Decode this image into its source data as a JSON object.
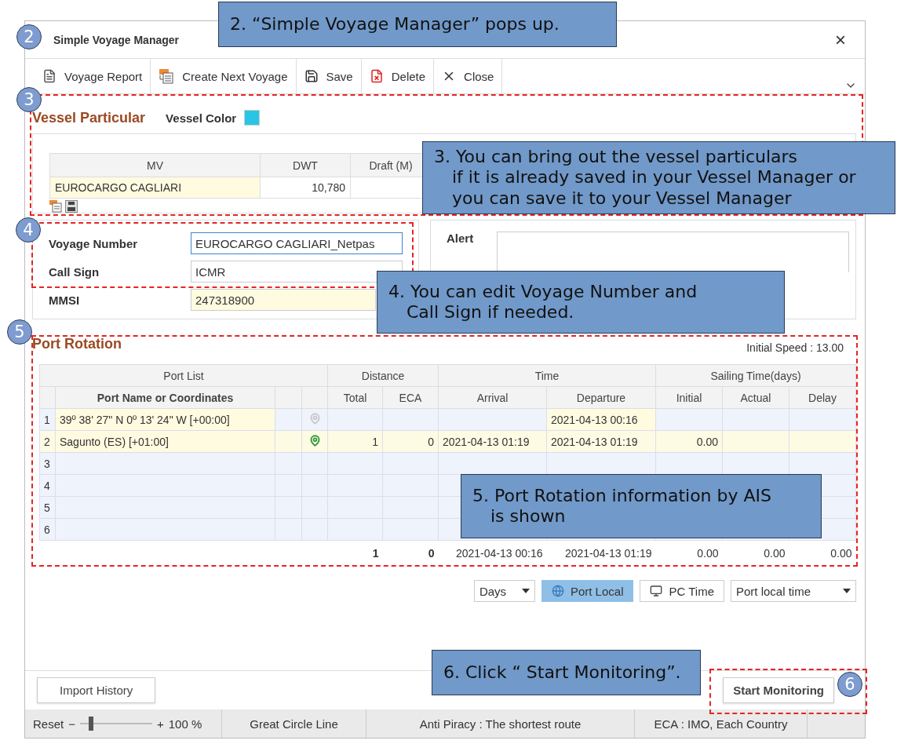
{
  "window": {
    "title": "Simple Voyage Manager",
    "close": "×"
  },
  "toolbar": [
    {
      "kind": "report",
      "label": "Voyage Report"
    },
    {
      "kind": "next",
      "label": "Create Next Voyage"
    },
    {
      "kind": "save",
      "label": "Save"
    },
    {
      "kind": "delete",
      "label": "Delete"
    },
    {
      "kind": "close",
      "label": "Close"
    }
  ],
  "vessel": {
    "title": "Vessel Particular",
    "color_label": "Vessel Color",
    "color": "#29c5e6",
    "columns": [
      "MV",
      "DWT",
      "Draft (M)"
    ],
    "row": {
      "mv": "EUROCARGO CAGLIARI",
      "dwt": "10,780"
    }
  },
  "voyage_fields": [
    {
      "label": "Voyage Number",
      "value": "EUROCARGO CAGLIARI_Netpas",
      "focused": true,
      "readonly": false
    },
    {
      "label": "Call Sign",
      "value": "ICMR",
      "focused": false,
      "readonly": false
    },
    {
      "label": "MMSI",
      "value": "247318900",
      "focused": false,
      "readonly": true
    }
  ],
  "alert": {
    "label": "Alert"
  },
  "port_rotation": {
    "title": "Port Rotation",
    "initial_speed": "Initial Speed :  13.00",
    "groups": [
      "Port List",
      "Distance",
      "Time",
      "Sailing Time(days)"
    ],
    "columns": [
      "Port Name or Coordinates",
      "Total",
      "ECA",
      "Arrival",
      "Departure",
      "Initial",
      "Actual",
      "Delay"
    ],
    "rows": [
      {
        "number": "1",
        "port": "39º 38' 27\" N 0º 13' 24\" W [+00:00]",
        "color": "#c8c8c8",
        "departure": "2021-04-13 00:16",
        "selected": false
      },
      {
        "number": "2",
        "port": "Sagunto (ES) [+01:00]",
        "color": "#2e9a3c",
        "total": "1",
        "eca": "0",
        "arrival": "2021-04-13 01:19",
        "departure": "2021-04-13 01:19",
        "initial": "0.00",
        "selected": true
      },
      {
        "number": "3",
        "selected": false
      },
      {
        "number": "4",
        "selected": false
      },
      {
        "number": "5",
        "selected": false
      },
      {
        "number": "6",
        "selected": false
      }
    ],
    "totals": {
      "total": "1",
      "eca": "0",
      "arrival": "2021-04-13 00:16",
      "departure": "2021-04-13 01:19",
      "initial": "0.00",
      "actual": "0.00",
      "delay": "0.00"
    }
  },
  "time_controls": {
    "unit": "Days",
    "toggles": [
      {
        "kind": "globe",
        "label": "Port Local",
        "selected": true
      },
      {
        "kind": "monitor",
        "label": "PC Time",
        "selected": false
      }
    ],
    "time_mode": "Port local time"
  },
  "footer": {
    "import": "Import History",
    "start": "Start Monitoring"
  },
  "status_bar": {
    "reset": "Reset",
    "zoom_out": "−",
    "zoom_in": "+",
    "level": 0.15,
    "zoom": "100 %",
    "segments": [
      "Great Circle Line",
      "Anti Piracy : The shortest route",
      "ECA : IMO, Each Country"
    ]
  },
  "step_markers": [
    "2",
    "3",
    "4",
    "5",
    "6"
  ],
  "callouts": [
    {
      "lines": [
        "2. “Simple Voyage Manager” pops up."
      ]
    },
    {
      "lines": [
        "3. You can bring out the vessel particulars",
        "if it is already saved in your Vessel Manager or",
        "you can save it to your Vessel Manager"
      ]
    },
    {
      "lines": [
        "4. You can edit Voyage Number and",
        "Call Sign if needed."
      ]
    },
    {
      "lines": [
        "5. Port Rotation information by AIS",
        "is shown"
      ]
    },
    {
      "lines": [
        "6. Click “ Start Monitoring”."
      ]
    }
  ]
}
